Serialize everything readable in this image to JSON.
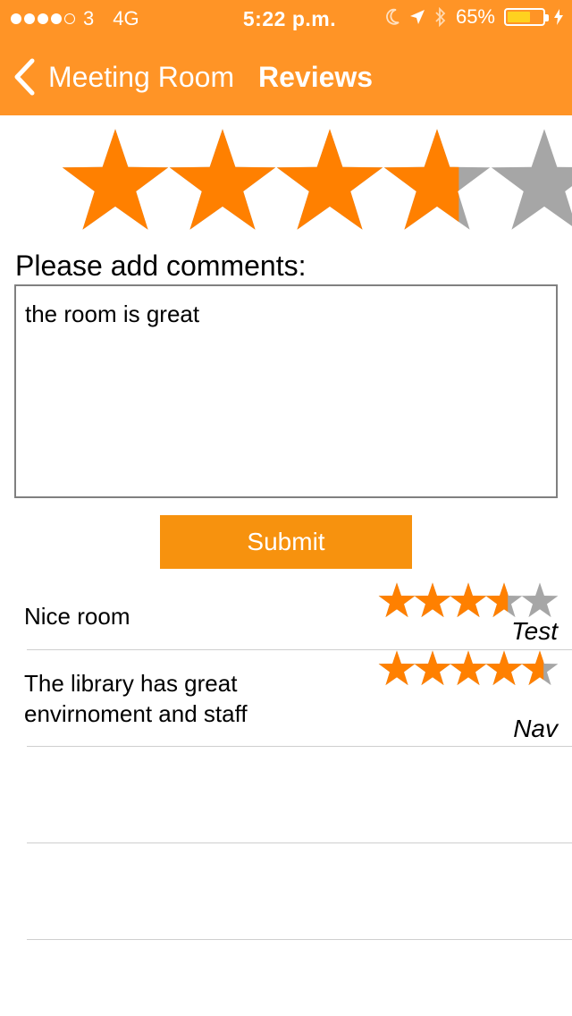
{
  "status_bar": {
    "carrier": "3",
    "network": "4G",
    "time": "5:22 p.m.",
    "battery_percent_label": "65%",
    "battery_level": 0.65,
    "signal_bars_filled": 4,
    "signal_bars_total": 5
  },
  "nav": {
    "back_label": "Meeting Room",
    "title": "Reviews"
  },
  "rating": {
    "value": 3.7,
    "max": 5
  },
  "comments": {
    "label": "Please add comments:",
    "value": "the room is great"
  },
  "submit_label": "Submit",
  "reviews": [
    {
      "text": "Nice room",
      "author": "Test",
      "rating": 3.6
    },
    {
      "text": "The library has great envirnoment and staff",
      "author": "Nav",
      "rating": 4.6
    }
  ],
  "colors": {
    "header": "#ff9426",
    "star_filled": "#ff8000",
    "star_empty": "#a6a6a6",
    "submit": "#f7920e"
  }
}
